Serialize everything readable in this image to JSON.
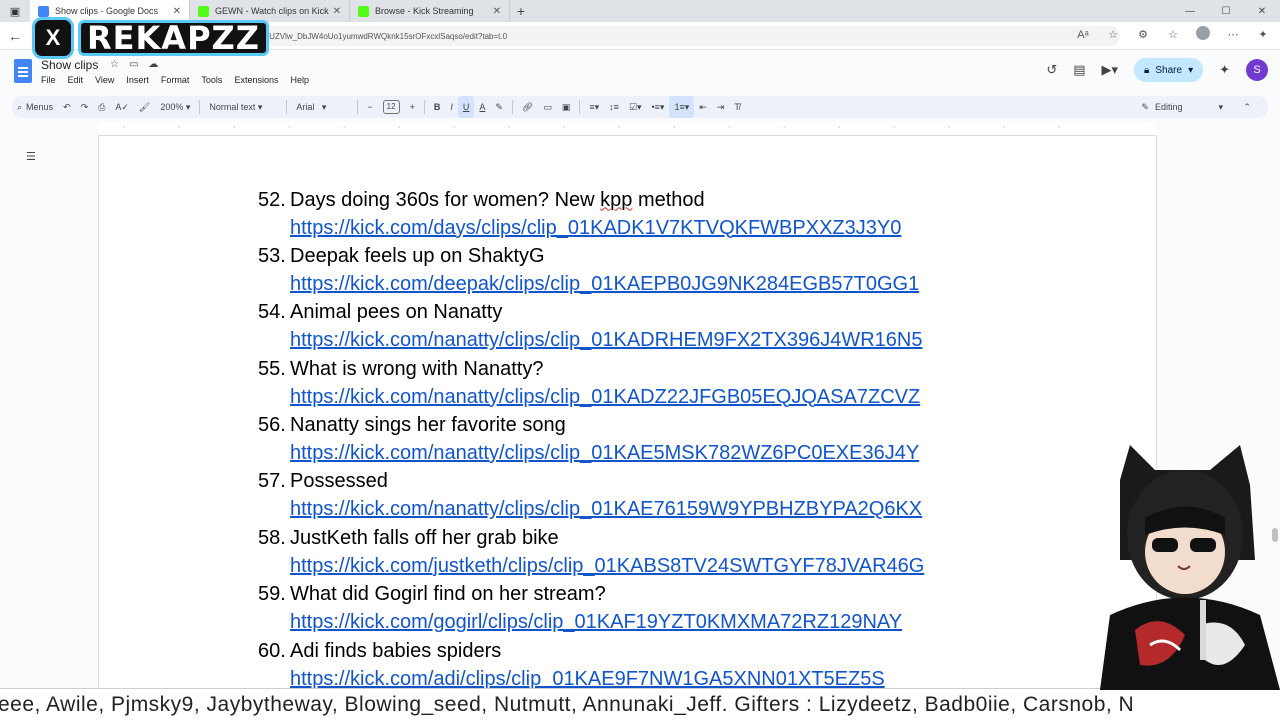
{
  "browser": {
    "tabs": [
      {
        "title": "Show clips - Google Docs",
        "active": true,
        "color": "#4285f4"
      },
      {
        "title": "GEWN - Watch clips on Kick",
        "active": false,
        "color": "#53fc18"
      },
      {
        "title": "Browse - Kick Streaming",
        "active": false,
        "color": "#53fc18"
      }
    ],
    "new_tab": "+",
    "url": "1vrUZVlw_DbJW4oUo1yumwdRWQknk15srOFxcxlSaqso/edit?tab=t.0"
  },
  "overlay": {
    "brand_text": "REKAPZZ",
    "x_label": "X"
  },
  "docs": {
    "title": "Show clips",
    "menu": [
      "File",
      "Edit",
      "View",
      "Insert",
      "Format",
      "Tools",
      "Extensions",
      "Help"
    ],
    "share_label": "Share",
    "avatar_letter": "S",
    "toolbar": {
      "menus_label": "Menus",
      "zoom": "200%",
      "style": "Normal text",
      "font": "Arial",
      "font_size": "12",
      "mode": "Editing"
    }
  },
  "list_items": [
    {
      "num": "52.",
      "title": "Days doing 360s for women? New kpp method",
      "link": "https://kick.com/days/clips/clip_01KADK1V7KTVQKFWBPXXZ3J3Y0"
    },
    {
      "num": "53.",
      "title": "Deepak feels up on ShaktyG",
      "link": "https://kick.com/deepak/clips/clip_01KAEPB0JG9NK284EGB57T0GG1"
    },
    {
      "num": "54.",
      "title": "Animal pees on Nanatty",
      "link": "https://kick.com/nanatty/clips/clip_01KADRHEM9FX2TX396J4WR16N5"
    },
    {
      "num": "55.",
      "title": "What is wrong with Nanatty?",
      "link": "https://kick.com/nanatty/clips/clip_01KADZ22JFGB05EQJQASA7ZCVZ"
    },
    {
      "num": "56.",
      "title": "Nanatty sings her favorite song",
      "link": "https://kick.com/nanatty/clips/clip_01KAE5MSK782WZ6PC0EXE36J4Y"
    },
    {
      "num": "57.",
      "title": "Possessed",
      "link": "https://kick.com/nanatty/clips/clip_01KAE76159W9YPBHZBYPA2Q6KX"
    },
    {
      "num": "58.",
      "title": "JustKeth falls off her grab bike",
      "link": "https://kick.com/justketh/clips/clip_01KABS8TV24SWTGYF78JVAR46G"
    },
    {
      "num": "59.",
      "title": " What did Gogirl find on her stream?",
      "link": "https://kick.com/gogirl/clips/clip_01KAF19YZT0KMXMA72RZ129NAY"
    },
    {
      "num": "60.",
      "title": "Adi finds babies spiders",
      "link": "https://kick.com/adi/clips/clip_01KAE9F7NW1GA5XNN01XT5EZ5S"
    }
  ],
  "ticker": "eee, Awile, Pjmsky9, Jaybytheway, Blowing_seed, Nutmutt, Annunaki_Jeff. Gifters : Lizydeetz, Badb0iie, Carsnob, N"
}
